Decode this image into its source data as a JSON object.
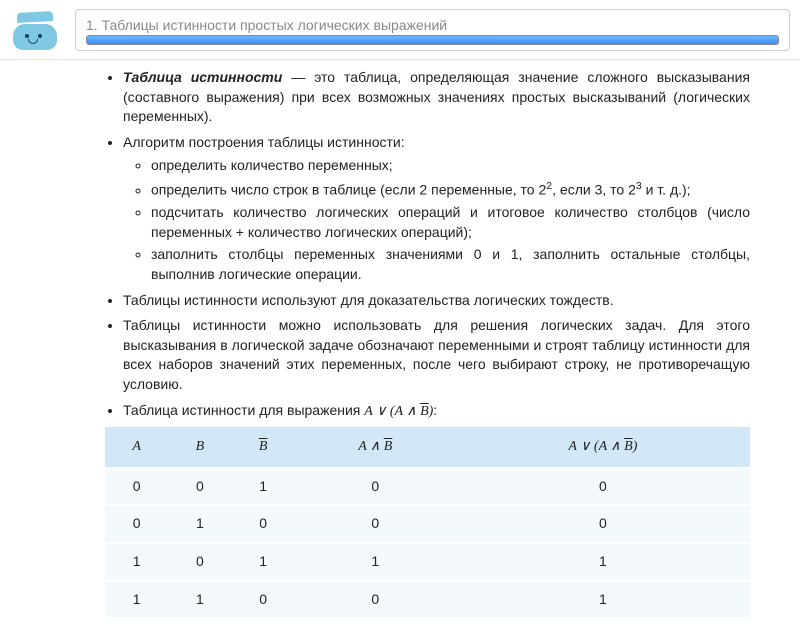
{
  "header": {
    "title": "1. Таблицы истинности простых логических выражений",
    "progress_pct": 100
  },
  "bullets": {
    "b1_term": "Таблица истинности",
    "b1_rest": " — это таблица, определяющая значение сложного высказывания (составного выражения) при всех возможных значениях простых высказываний (логических переменных).",
    "b2": "Алгоритм построения таблицы истинности:",
    "b2_sub": [
      "определить количество переменных;",
      "определить число строк в таблице (если 2 переменные, то 2², если 3, то 2³ и т. д.);",
      "подсчитать количество логических операций и итоговое количество столбцов (число переменных + количество логических операций);",
      "заполнить столбцы переменных значениями 0 и 1, заполнить остальные столбцы, выполнив логические операции."
    ],
    "b3": "Таблицы истинности используют для доказательства логических тождеств.",
    "b4": "Таблицы истинности можно использовать для решения логических задач. Для этого высказывания в логической задаче обозначают переменными и строят таблицу истинности для всех наборов значений этих переменных, после чего выбирают строку, не противоречащую условию.",
    "b5_prefix": "Таблица истинности для выражения "
  },
  "formula": {
    "A": "A",
    "B": "B",
    "notB": "B",
    "or": "∨",
    "and": "∧"
  },
  "chart_data": {
    "type": "table",
    "columns": [
      "A",
      "B",
      "¬B",
      "A ∧ ¬B",
      "A ∨ (A ∧ ¬B)"
    ],
    "rows": [
      [
        0,
        0,
        1,
        0,
        0
      ],
      [
        0,
        1,
        0,
        0,
        0
      ],
      [
        1,
        0,
        1,
        1,
        1
      ],
      [
        1,
        1,
        0,
        0,
        1
      ]
    ]
  }
}
